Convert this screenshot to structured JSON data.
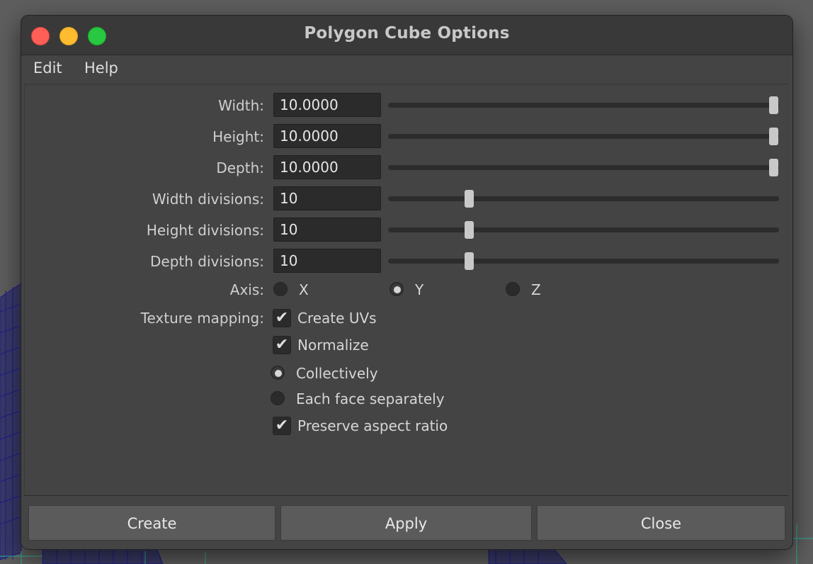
{
  "window": {
    "title": "Polygon Cube Options"
  },
  "menu": {
    "items": [
      "Edit",
      "Help"
    ]
  },
  "fields": [
    {
      "label": "Width:",
      "value": "10.0000",
      "slider": 1.0
    },
    {
      "label": "Height:",
      "value": "10.0000",
      "slider": 1.0
    },
    {
      "label": "Depth:",
      "value": "10.0000",
      "slider": 1.0
    },
    {
      "label": "Width divisions:",
      "value": "10",
      "slider": 0.2
    },
    {
      "label": "Height divisions:",
      "value": "10",
      "slider": 0.2
    },
    {
      "label": "Depth divisions:",
      "value": "10",
      "slider": 0.2
    }
  ],
  "axis": {
    "label": "Axis:",
    "options": [
      "X",
      "Y",
      "Z"
    ],
    "selected": "Y"
  },
  "texture_mapping": {
    "label": "Texture mapping:",
    "create_uvs": {
      "label": "Create UVs",
      "checked": true
    },
    "normalize": {
      "label": "Normalize",
      "checked": true
    },
    "collectively": {
      "label": "Collectively",
      "selected": true
    },
    "each_face": {
      "label": "Each face separately",
      "selected": false
    },
    "preserve_aspect": {
      "label": "Preserve aspect ratio",
      "checked": true
    }
  },
  "buttons": {
    "create": "Create",
    "apply": "Apply",
    "close": "Close"
  },
  "colors": {
    "panel": "#444444",
    "field": "#2b2b2b",
    "button": "#5b5b5b",
    "close_light": "#ff5f57",
    "minimize_light": "#febc2e",
    "maximize_light": "#28c840"
  }
}
